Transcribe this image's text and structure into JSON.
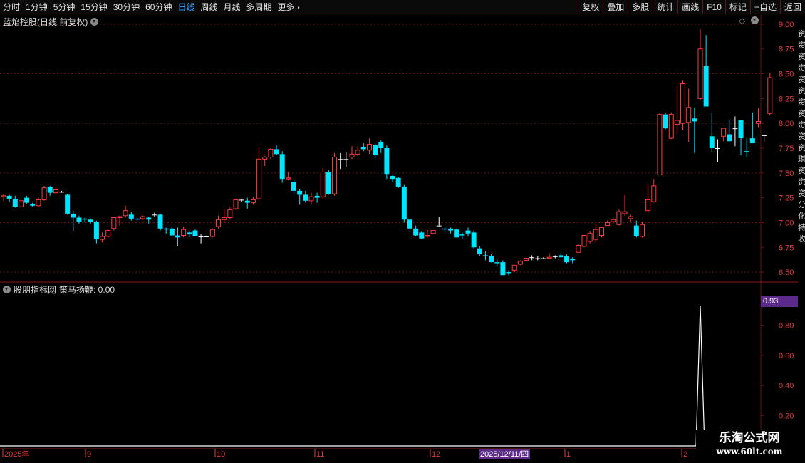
{
  "toolbar": {
    "periods": [
      "分时",
      "1分钟",
      "5分钟",
      "15分钟",
      "30分钟",
      "60分钟",
      "日线",
      "周线",
      "月线",
      "多周期",
      "更多"
    ],
    "active_period": "日线",
    "tools": [
      "复权",
      "叠加",
      "多股",
      "统计",
      "画线",
      "F10",
      "标记",
      "+自选",
      "返回"
    ]
  },
  "main_panel": {
    "title": "蓝焰控股(日线 前复权)",
    "price_axis": [
      "9.00",
      "8.75",
      "8.50",
      "8.25",
      "8.00",
      "7.75",
      "7.50",
      "7.25",
      "7.00",
      "6.75",
      "6.50"
    ]
  },
  "indicator_panel": {
    "name": "股朋指标网",
    "series_label": "策马扬鞭: 0.00",
    "axis": [
      "0.80",
      "0.60",
      "0.40",
      "0.20"
    ],
    "current_value_tag": "0.93"
  },
  "time_axis": {
    "labels": [
      "2025年",
      "9",
      "10",
      "11",
      "12",
      "1",
      "2"
    ],
    "cursor_date": "2025/12/11/四"
  },
  "watermark": {
    "title": "乐淘公式网",
    "url": "www.60lt.com"
  },
  "colors": {
    "up": "#ff3c3c",
    "down": "#00e5ff",
    "flat": "#ffffff",
    "grid": "#6a1010",
    "axis_text": "#e03c3c",
    "highlight": "#5b2a8a"
  },
  "chart_data": [
    {
      "type": "candlestick",
      "title": "蓝焰控股(日线 前复权)",
      "ylim": [
        6.4,
        9.1
      ],
      "candles": [
        [
          7.26,
          7.29,
          7.22,
          7.27
        ],
        [
          7.27,
          7.28,
          7.21,
          7.24
        ],
        [
          7.24,
          7.27,
          7.15,
          7.16
        ],
        [
          7.16,
          7.24,
          7.15,
          7.22
        ],
        [
          7.25,
          7.27,
          7.19,
          7.2
        ],
        [
          7.19,
          7.2,
          7.16,
          7.17
        ],
        [
          7.17,
          7.25,
          7.16,
          7.23
        ],
        [
          7.23,
          7.37,
          7.22,
          7.35
        ],
        [
          7.36,
          7.37,
          7.27,
          7.3
        ],
        [
          7.3,
          7.36,
          7.29,
          7.33
        ],
        [
          7.31,
          7.32,
          7.3,
          7.31
        ],
        [
          7.28,
          7.29,
          7.08,
          7.09
        ],
        [
          7.09,
          7.12,
          6.91,
          7.05
        ],
        [
          7.05,
          7.07,
          6.99,
          7.01
        ],
        [
          7.04,
          7.05,
          7.0,
          7.03
        ],
        [
          7.03,
          7.04,
          6.99,
          7.01
        ],
        [
          7.01,
          7.02,
          6.79,
          6.83
        ],
        [
          6.83,
          6.9,
          6.8,
          6.86
        ],
        [
          6.86,
          6.93,
          6.85,
          6.92
        ],
        [
          6.94,
          7.06,
          6.92,
          7.05
        ],
        [
          7.05,
          7.07,
          6.97,
          7.06
        ],
        [
          7.07,
          7.17,
          7.05,
          7.12
        ],
        [
          7.08,
          7.11,
          7.02,
          7.04
        ],
        [
          7.04,
          7.05,
          7.02,
          7.03
        ],
        [
          7.04,
          7.07,
          7.03,
          7.06
        ],
        [
          7.05,
          7.06,
          6.99,
          7.03
        ],
        [
          7.08,
          7.1,
          7.06,
          7.08
        ],
        [
          7.08,
          7.09,
          6.92,
          6.94
        ],
        [
          6.94,
          6.95,
          6.89,
          6.93
        ],
        [
          6.94,
          6.96,
          6.86,
          6.87
        ],
        [
          6.87,
          6.95,
          6.76,
          6.85
        ],
        [
          6.87,
          6.96,
          6.85,
          6.93
        ],
        [
          6.9,
          6.92,
          6.85,
          6.88
        ],
        [
          6.92,
          6.93,
          6.87,
          6.86
        ],
        [
          6.86,
          6.88,
          6.79,
          6.86
        ],
        [
          6.86,
          6.87,
          6.85,
          6.86
        ],
        [
          6.86,
          6.94,
          6.85,
          6.93
        ],
        [
          6.96,
          7.07,
          6.94,
          7.03
        ],
        [
          7.03,
          7.13,
          7.0,
          7.05
        ],
        [
          7.05,
          7.15,
          7.03,
          7.13
        ],
        [
          7.14,
          7.24,
          7.13,
          7.23
        ],
        [
          7.23,
          7.24,
          7.21,
          7.23
        ],
        [
          7.22,
          7.25,
          7.14,
          7.2
        ],
        [
          7.2,
          7.26,
          7.18,
          7.23
        ],
        [
          7.24,
          7.76,
          7.22,
          7.64
        ],
        [
          7.64,
          7.67,
          7.57,
          7.66
        ],
        [
          7.66,
          7.75,
          7.64,
          7.74
        ],
        [
          7.74,
          7.78,
          7.68,
          7.69
        ],
        [
          7.69,
          7.72,
          7.4,
          7.44
        ],
        [
          7.44,
          7.51,
          7.43,
          7.45
        ],
        [
          7.41,
          7.43,
          7.28,
          7.32
        ],
        [
          7.32,
          7.34,
          7.18,
          7.28
        ],
        [
          7.28,
          7.32,
          7.2,
          7.22
        ],
        [
          7.22,
          7.3,
          7.18,
          7.26
        ],
        [
          7.27,
          7.3,
          7.2,
          7.25
        ],
        [
          7.26,
          7.55,
          7.24,
          7.51
        ],
        [
          7.51,
          7.53,
          7.28,
          7.29
        ],
        [
          7.29,
          7.7,
          7.27,
          7.66
        ],
        [
          7.64,
          7.7,
          7.54,
          7.64
        ],
        [
          7.64,
          7.71,
          7.56,
          7.64
        ],
        [
          7.66,
          7.77,
          7.64,
          7.69
        ],
        [
          7.69,
          7.77,
          7.67,
          7.73
        ],
        [
          7.76,
          7.8,
          7.72,
          7.74
        ],
        [
          7.73,
          7.85,
          7.69,
          7.79
        ],
        [
          7.78,
          7.8,
          7.65,
          7.68
        ],
        [
          7.81,
          7.83,
          7.7,
          7.75
        ],
        [
          7.75,
          7.78,
          7.44,
          7.49
        ],
        [
          7.47,
          7.48,
          7.41,
          7.44
        ],
        [
          7.45,
          7.46,
          7.35,
          7.36
        ],
        [
          7.36,
          7.38,
          7.0,
          7.03
        ],
        [
          7.03,
          7.04,
          6.9,
          6.94
        ],
        [
          6.94,
          6.97,
          6.86,
          6.87
        ],
        [
          6.9,
          6.91,
          6.83,
          6.84
        ],
        [
          6.86,
          6.93,
          6.85,
          6.87
        ],
        [
          6.89,
          6.9,
          6.88,
          6.92
        ],
        [
          6.97,
          7.06,
          6.97,
          6.97
        ],
        [
          6.94,
          6.96,
          6.9,
          6.93
        ],
        [
          6.94,
          6.95,
          6.89,
          6.92
        ],
        [
          6.93,
          6.94,
          6.86,
          6.85
        ],
        [
          6.88,
          6.9,
          6.83,
          6.87
        ],
        [
          6.92,
          6.95,
          6.86,
          6.89
        ],
        [
          6.9,
          6.92,
          6.73,
          6.75
        ],
        [
          6.74,
          6.76,
          6.66,
          6.68
        ],
        [
          6.67,
          6.71,
          6.62,
          6.66
        ],
        [
          6.66,
          6.68,
          6.6,
          6.6
        ],
        [
          6.6,
          6.63,
          6.56,
          6.59
        ],
        [
          6.6,
          6.62,
          6.48,
          6.47
        ],
        [
          6.5,
          6.52,
          6.47,
          6.49
        ],
        [
          6.52,
          6.57,
          6.5,
          6.57
        ],
        [
          6.58,
          6.62,
          6.57,
          6.61
        ],
        [
          6.62,
          6.65,
          6.61,
          6.64
        ],
        [
          6.65,
          6.67,
          6.62,
          6.65
        ],
        [
          6.64,
          6.66,
          6.62,
          6.64
        ],
        [
          6.64,
          6.65,
          6.63,
          6.64
        ],
        [
          6.64,
          6.69,
          6.63,
          6.65
        ],
        [
          6.66,
          6.67,
          6.64,
          6.66
        ],
        [
          6.67,
          6.69,
          6.65,
          6.65
        ],
        [
          6.66,
          6.68,
          6.59,
          6.6
        ],
        [
          6.63,
          6.65,
          6.59,
          6.62
        ],
        [
          6.7,
          6.78,
          6.7,
          6.77
        ],
        [
          6.76,
          6.86,
          6.75,
          6.87
        ],
        [
          6.81,
          6.91,
          6.79,
          6.89
        ],
        [
          6.83,
          6.99,
          6.8,
          6.93
        ],
        [
          6.87,
          6.95,
          6.85,
          6.95
        ],
        [
          6.97,
          7.02,
          6.97,
          7.0
        ],
        [
          7.01,
          7.05,
          6.99,
          7.03
        ],
        [
          6.98,
          7.13,
          6.97,
          7.11
        ],
        [
          7.09,
          7.28,
          7.07,
          7.11
        ],
        [
          7.04,
          7.08,
          7.01,
          7.06
        ],
        [
          6.97,
          7.02,
          6.85,
          6.86
        ],
        [
          6.86,
          7.01,
          6.85,
          6.98
        ],
        [
          7.12,
          7.39,
          7.1,
          7.23
        ],
        [
          7.21,
          7.44,
          7.2,
          7.37
        ],
        [
          7.48,
          8.1,
          7.48,
          8.09
        ],
        [
          8.09,
          8.11,
          7.94,
          7.95
        ],
        [
          7.85,
          8.11,
          7.84,
          8.09
        ],
        [
          7.99,
          8.37,
          7.89,
          8.03
        ],
        [
          8.0,
          8.43,
          7.93,
          8.4
        ],
        [
          8.01,
          8.35,
          7.81,
          8.16
        ],
        [
          8.05,
          8.16,
          7.7,
          8.02
        ],
        [
          8.25,
          8.95,
          8.23,
          8.75
        ],
        [
          8.58,
          8.89,
          8.17,
          8.17
        ],
        [
          7.87,
          8.11,
          7.71,
          7.75
        ],
        [
          7.75,
          7.84,
          7.61,
          7.75
        ],
        [
          7.87,
          7.95,
          7.82,
          7.95
        ],
        [
          7.89,
          8.04,
          7.82,
          7.82
        ],
        [
          7.95,
          8.07,
          7.77,
          7.95
        ],
        [
          8.03,
          8.03,
          7.68,
          7.85
        ],
        [
          7.72,
          7.85,
          7.66,
          7.71
        ],
        [
          7.85,
          8.11,
          7.83,
          7.8
        ],
        [
          8.0,
          8.15,
          7.96,
          8.02
        ],
        [
          7.88,
          7.89,
          7.81,
          7.88
        ],
        [
          8.1,
          8.51,
          8.08,
          8.46
        ]
      ]
    },
    {
      "type": "line",
      "name": "策马扬鞭",
      "ylim": [
        0,
        1.0
      ],
      "x": [
        "2025-07",
        "2025-09",
        "2025-10",
        "2025-11",
        "2025-12",
        "2026-01",
        "2026-02"
      ],
      "spike": {
        "index": 120,
        "value": 0.93
      }
    }
  ]
}
